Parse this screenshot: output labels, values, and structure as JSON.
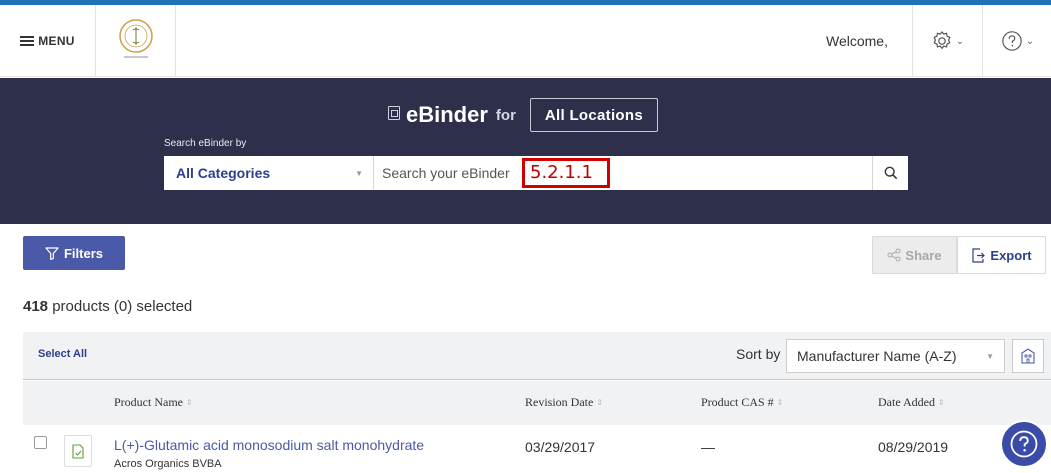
{
  "header": {
    "menu_label": "MENU",
    "welcome_text": "Welcome,"
  },
  "banner": {
    "title": "eBinder",
    "for_text": "for",
    "location_button": "All Locations",
    "search_by_label": "Search eBinder by",
    "category_selected": "All Categories",
    "search_placeholder": "Search your eBinder",
    "search_value": "",
    "annotation_text": "5.2.1.1"
  },
  "toolbar": {
    "filters_label": "Filters",
    "share_label": "Share",
    "export_label": "Export"
  },
  "results": {
    "count": "418",
    "count_suffix": " products (0) selected"
  },
  "sort": {
    "select_all_label": "Select All",
    "sort_by_label": "Sort by",
    "sort_selected": "Manufacturer Name (A-Z)"
  },
  "table": {
    "columns": [
      "Product Name",
      "Revision Date",
      "Product CAS #",
      "Date Added"
    ],
    "rows": [
      {
        "product_name": "L(+)-Glutamic acid monosodium salt monohydrate",
        "manufacturer": "Acros Organics BVBA",
        "revision_date": "03/29/2017",
        "cas": "—",
        "date_added": "08/29/2019"
      }
    ]
  },
  "colors": {
    "banner_bg": "#2e2f4a",
    "accent": "#4b5aa8",
    "link": "#2d3f8c",
    "annotation": "#d00000"
  }
}
